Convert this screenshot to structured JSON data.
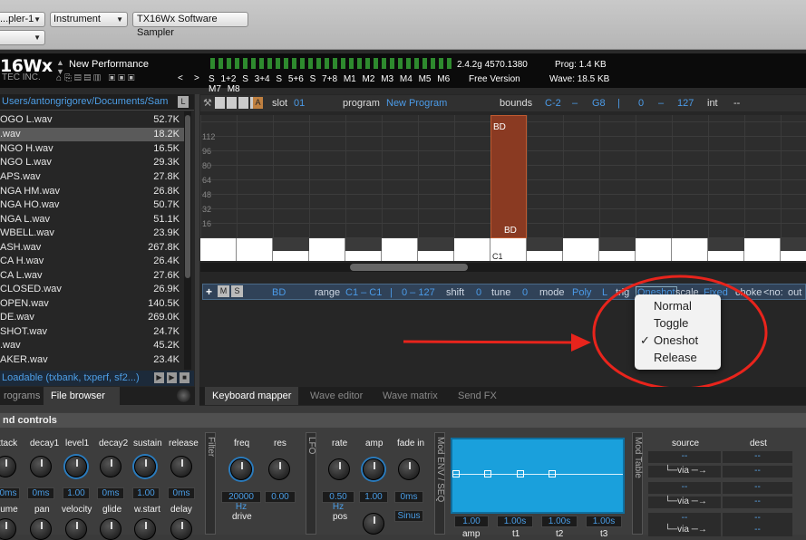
{
  "host": {
    "preset_select": "...pler-1",
    "track_select": "",
    "instrument_select": "Instrument",
    "plugin_name": "TX16Wx Software Sampler"
  },
  "header": {
    "logo": "16Wx",
    "company": "TEC INC.",
    "performance": "New Performance",
    "version": "2.4.2g 4570.1380",
    "prog": "Prog: 1.4 KB",
    "free": "Free Version",
    "wave": "Wave: 18.5 KB",
    "slot_buttons": [
      "S 1+2",
      "S 3+4",
      "S 5+6",
      "S 7+8"
    ],
    "mod_buttons": [
      "M1",
      "M2",
      "M3",
      "M4",
      "M5",
      "M6",
      "M7",
      "M8"
    ]
  },
  "browser": {
    "path": "Users/antongrigorev/Documents/Sam",
    "files": [
      {
        "name": "OGO L.wav",
        "size": "52.7K"
      },
      {
        "name": ".wav",
        "size": "18.2K"
      },
      {
        "name": "NGO H.wav",
        "size": "16.5K"
      },
      {
        "name": "NGO L.wav",
        "size": "29.3K"
      },
      {
        "name": "APS.wav",
        "size": "27.8K"
      },
      {
        "name": "NGA HM.wav",
        "size": "26.8K"
      },
      {
        "name": "NGA HO.wav",
        "size": "50.7K"
      },
      {
        "name": "NGA L.wav",
        "size": "51.1K"
      },
      {
        "name": "WBELL.wav",
        "size": "23.9K"
      },
      {
        "name": "ASH.wav",
        "size": "267.8K"
      },
      {
        "name": "CA H.wav",
        "size": "26.4K"
      },
      {
        "name": "CA L.wav",
        "size": "27.6K"
      },
      {
        "name": " CLOSED.wav",
        "size": "26.9K"
      },
      {
        "name": " OPEN.wav",
        "size": "140.5K"
      },
      {
        "name": "DE.wav",
        "size": "269.0K"
      },
      {
        "name": " SHOT.wav",
        "size": "24.7K"
      },
      {
        "name": ".wav",
        "size": "45.2K"
      },
      {
        "name": "AKER.wav",
        "size": "23.4K"
      }
    ],
    "filter": "Loadable (txbank, txperf, sf2...)",
    "tabs": [
      "rograms",
      "File browser"
    ]
  },
  "mapper": {
    "slot_label": "slot",
    "slot_value": "01",
    "program_label": "program",
    "program_value": "New Program",
    "bounds_label": "bounds",
    "bound_low": "C-2",
    "dash": "–",
    "bound_high": "G8",
    "sep": "|",
    "vel_low": "0",
    "vel_high": "127",
    "int_label": "int",
    "int_value": "--",
    "y_ticks": [
      "112",
      "96",
      "80",
      "64",
      "48",
      "32",
      "16"
    ],
    "zone_name_top": "BD",
    "zone_name_bottom": "BD",
    "key_label": "C1"
  },
  "zone": {
    "name": "BD",
    "range_label": "range",
    "range_value": "C1 – C1",
    "vel_value": "0 – 127",
    "shift_label": "shift",
    "shift_value": "0",
    "tune_label": "tune",
    "tune_value": "0",
    "mode_label": "mode",
    "mode_value": "Poly",
    "l_label": "L",
    "trig_label": "trig",
    "trig_value": "Oneshot",
    "scale_label": "scale",
    "scale_value": "Fixed",
    "choke_label": "choke",
    "choke_value": "<no:",
    "out_label": "out"
  },
  "trigger_menu": {
    "items": [
      "Normal",
      "Toggle",
      "Oneshot",
      "Release"
    ],
    "checked": "Oneshot",
    "check": "✓"
  },
  "main_tabs": [
    "Keyboard mapper",
    "Wave editor",
    "Wave matrix",
    "Send FX"
  ],
  "sound": {
    "title": "nd controls",
    "amp_labels": [
      "ttack",
      "decay1",
      "level1",
      "decay2",
      "sustain",
      "release"
    ],
    "amp_values": [
      "0ms",
      "0ms",
      "1.00",
      "0ms",
      "1.00",
      "0ms"
    ],
    "row2_labels": [
      "lume",
      "pan",
      "velocity",
      "glide",
      "w.start",
      "delay"
    ],
    "filter_title": "Filter",
    "filter_labels": [
      "freq",
      "res"
    ],
    "filter_values": [
      "20000 Hz",
      "0.00"
    ],
    "drive_label": "drive",
    "lfo_title": "LFO",
    "lfo_labels": [
      "rate",
      "amp",
      "fade in"
    ],
    "lfo_values": [
      "0.50 Hz",
      "1.00",
      "0ms"
    ],
    "pos_label": "pos",
    "shape_value": "Sinus",
    "modenv_title": "Mod ENV / SEQ",
    "modenv_values": [
      "1.00",
      "1.00s",
      "1.00s",
      "1.00s"
    ],
    "modenv_labels": [
      "amp",
      "t1",
      "t2",
      "t3"
    ],
    "modtable_title": "Mod Table",
    "mod_source": "source",
    "mod_dest": "dest",
    "mod_empty": "--",
    "mod_via": "└─via ─→"
  }
}
